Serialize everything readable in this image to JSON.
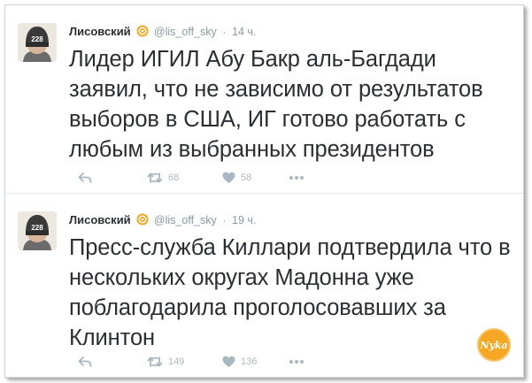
{
  "tweets": [
    {
      "display_name": "Лисовский",
      "handle": "@lis_off_sky",
      "separator": "·",
      "time": "14 ч.",
      "avatar_number": "228",
      "text": "Лидер ИГИЛ Абу Бакр аль-Багдади заявил, что не зависимо от результатов выборов в США, ИГ готово работать с любым из выбранных президентов",
      "retweets": "68",
      "likes": "58"
    },
    {
      "display_name": "Лисовский",
      "handle": "@lis_off_sky",
      "separator": "·",
      "time": "19 ч.",
      "avatar_number": "228",
      "text": "Пресс-служба Киллари подтвердила что в нескольких округах Мадонна уже поблагодарила проголосовавших за Клинтон",
      "retweets": "149",
      "likes": "136"
    }
  ],
  "watermark": {
    "text": "Nyka",
    "color": "#f5a623"
  },
  "colors": {
    "text": "#292f33",
    "muted": "#8899a6",
    "action": "#aab8c2",
    "verified_badge": "#f5a623",
    "divider": "#e1e8ed"
  },
  "icons": [
    "reply-icon",
    "retweet-icon",
    "like-icon",
    "more-icon",
    "verified-badge-icon"
  ]
}
